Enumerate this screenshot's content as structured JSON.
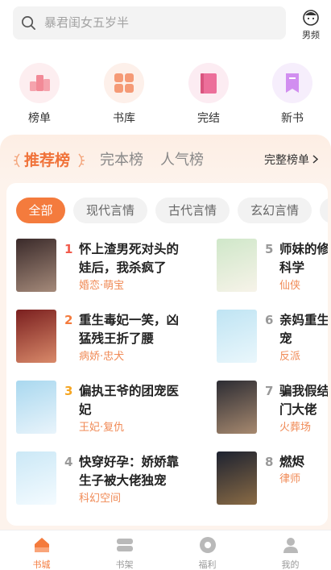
{
  "search": {
    "placeholder": "暴君闺女五岁半"
  },
  "gender": {
    "label": "男频"
  },
  "categories": [
    {
      "label": "榜单",
      "icon": "ranking-icon",
      "bg": "#fdeef0",
      "color": "#f28a97"
    },
    {
      "label": "书库",
      "icon": "library-icon",
      "bg": "#fdf0ea",
      "color": "#f59a76"
    },
    {
      "label": "完结",
      "icon": "finished-book-icon",
      "bg": "#fcecf2",
      "color": "#ec6f9a"
    },
    {
      "label": "新书",
      "icon": "new-book-icon",
      "bg": "#f6eefc",
      "color": "#d18ef0"
    }
  ],
  "rank_tabs": {
    "active": "推荐榜",
    "others": [
      "完本榜",
      "人气榜"
    ],
    "full": "完整榜单"
  },
  "chips": [
    {
      "label": "全部",
      "active": true
    },
    {
      "label": "现代言情",
      "active": false
    },
    {
      "label": "古代言情",
      "active": false
    },
    {
      "label": "玄幻言情",
      "active": false
    },
    {
      "label": "",
      "active": false
    }
  ],
  "books": [
    {
      "rank": "1",
      "title": "怀上渣男死对头的娃后，我杀疯了",
      "tag": "婚恋·萌宝",
      "rank_color": "#f15b4c",
      "cover": [
        "#3a2a2a",
        "#a58a7a"
      ]
    },
    {
      "rank": "2",
      "title": "重生毒妃一笑，凶猛残王折了腰",
      "tag": "病娇·忠犬",
      "rank_color": "#f47b3d",
      "cover": [
        "#7a1f1f",
        "#d98a6a"
      ]
    },
    {
      "rank": "3",
      "title": "偏执王爷的团宠医妃",
      "tag": "王妃·复仇",
      "rank_color": "#f5a623",
      "cover": [
        "#a9d8ef",
        "#e9f4fb"
      ]
    },
    {
      "rank": "4",
      "title": "快穿好孕：娇娇靠生子被大佬独宠",
      "tag": "科幻空间",
      "rank_color": "#999999",
      "cover": [
        "#cbe8f6",
        "#f4fbff"
      ]
    },
    {
      "rank": "5",
      "title": "师妹的修炼方式不科学",
      "tag": "仙侠",
      "rank_color": "#999999",
      "cover": [
        "#cfe7c9",
        "#f7f3e9"
      ]
    },
    {
      "rank": "6",
      "title": "亲妈重生，儿子争宠",
      "tag": "反派",
      "rank_color": "#999999",
      "cover": [
        "#bfe4f3",
        "#eaf7fc"
      ]
    },
    {
      "rank": "7",
      "title": "骗我假结婚？嫁豪门大佬",
      "tag": "火葬场",
      "rank_color": "#999999",
      "cover": [
        "#2c2c33",
        "#a7896f"
      ]
    },
    {
      "rank": "8",
      "title": "燃烬",
      "tag": "律师",
      "rank_color": "#999999",
      "cover": [
        "#1d2230",
        "#8a6b45"
      ]
    }
  ],
  "bottom_nav": [
    {
      "label": "书城",
      "icon": "bookstore-icon",
      "active": true
    },
    {
      "label": "书架",
      "icon": "bookshelf-icon",
      "active": false
    },
    {
      "label": "福利",
      "icon": "welfare-icon",
      "active": false
    },
    {
      "label": "我的",
      "icon": "profile-icon",
      "active": false
    }
  ],
  "colors": {
    "accent": "#f47b3d",
    "tag": "#f08a56"
  }
}
